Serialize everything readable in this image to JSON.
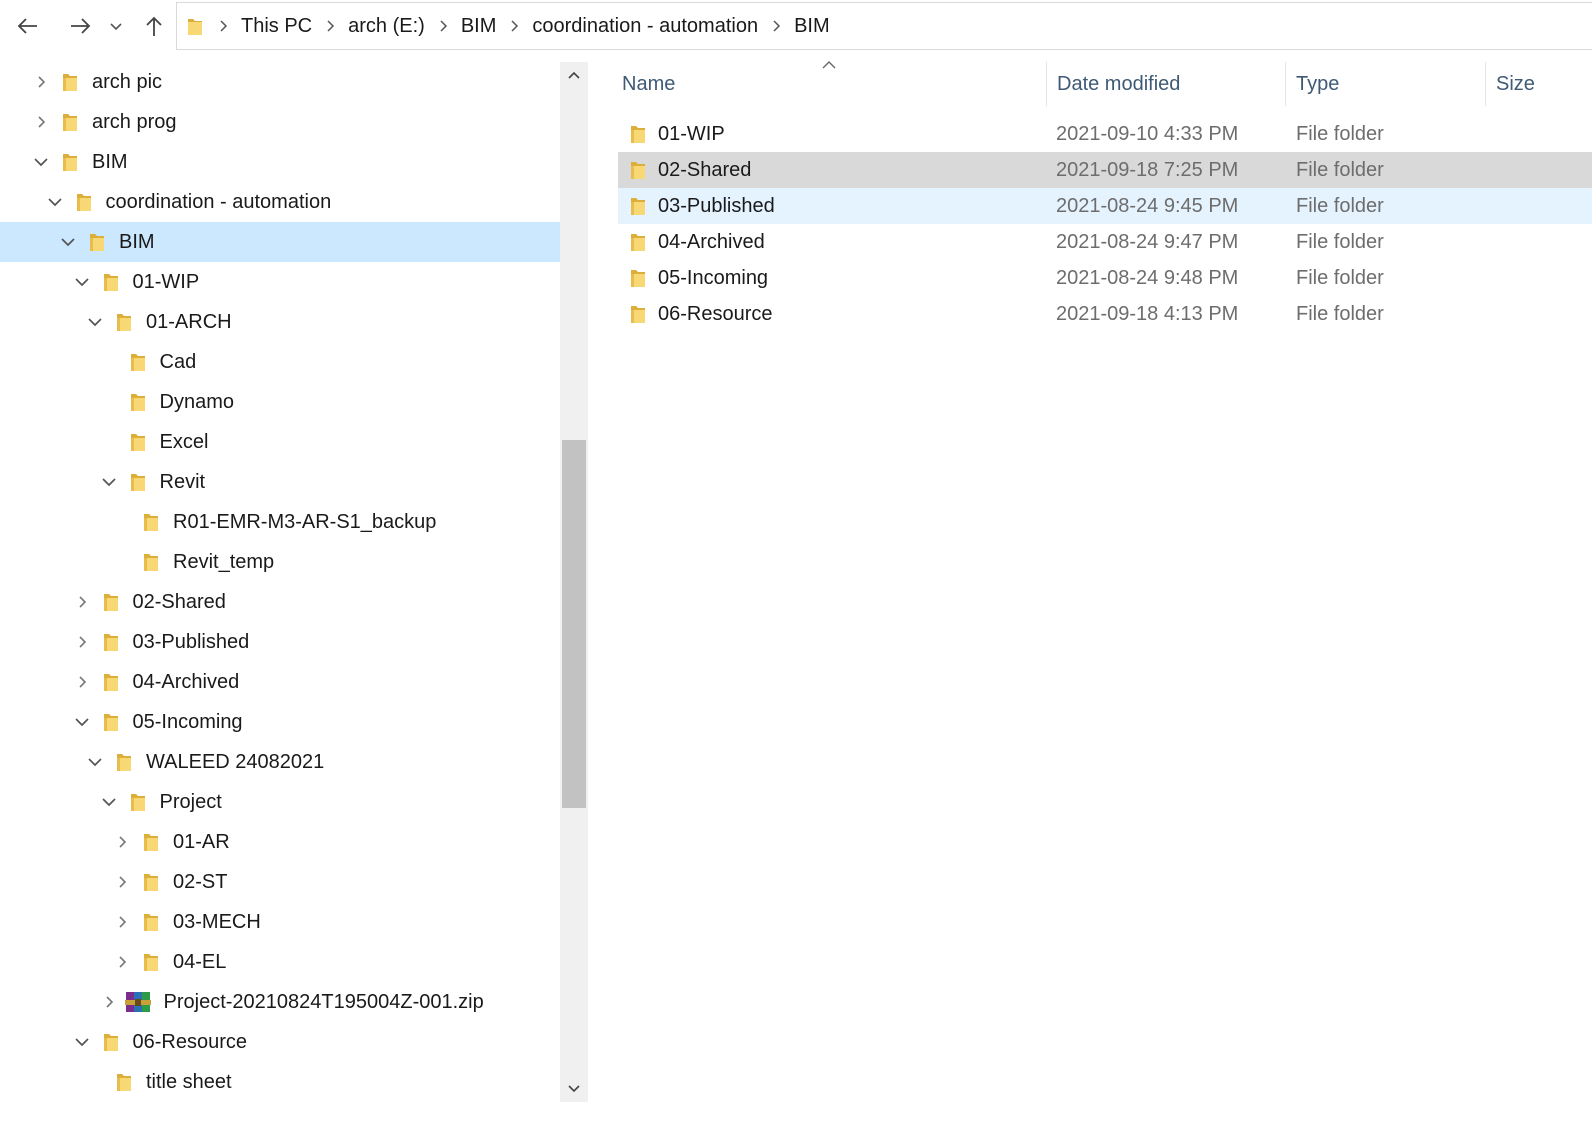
{
  "toolbar": {
    "back_icon": "arrow-left-icon",
    "forward_icon": "arrow-right-icon",
    "recent_icon": "chevron-down-icon",
    "up_icon": "arrow-up-icon",
    "breadcrumb": [
      "This PC",
      "arch (E:)",
      "BIM",
      "coordination - automation",
      "BIM"
    ]
  },
  "tree": {
    "items": [
      {
        "label": "arch pic",
        "level": 0,
        "state": "collapsed",
        "icon": "folder"
      },
      {
        "label": "arch prog",
        "level": 0,
        "state": "collapsed",
        "icon": "folder"
      },
      {
        "label": "BIM",
        "level": 0,
        "state": "expanded",
        "icon": "folder"
      },
      {
        "label": "coordination - automation",
        "level": 1,
        "state": "expanded",
        "icon": "folder"
      },
      {
        "label": "BIM",
        "level": 2,
        "state": "expanded",
        "icon": "folder",
        "selected": true
      },
      {
        "label": "01-WIP",
        "level": 3,
        "state": "expanded",
        "icon": "folder"
      },
      {
        "label": "01-ARCH",
        "level": 4,
        "state": "expanded",
        "icon": "folder"
      },
      {
        "label": "Cad",
        "level": 5,
        "state": "none",
        "icon": "folder"
      },
      {
        "label": "Dynamo",
        "level": 5,
        "state": "none",
        "icon": "folder"
      },
      {
        "label": "Excel",
        "level": 5,
        "state": "none",
        "icon": "folder"
      },
      {
        "label": "Revit",
        "level": 5,
        "state": "expanded",
        "icon": "folder"
      },
      {
        "label": "R01-EMR-M3-AR-S1_backup",
        "level": 6,
        "state": "none",
        "icon": "folder"
      },
      {
        "label": "Revit_temp",
        "level": 6,
        "state": "none",
        "icon": "folder"
      },
      {
        "label": "02-Shared",
        "level": 3,
        "state": "collapsed",
        "icon": "folder"
      },
      {
        "label": "03-Published",
        "level": 3,
        "state": "collapsed",
        "icon": "folder"
      },
      {
        "label": "04-Archived",
        "level": 3,
        "state": "collapsed",
        "icon": "folder"
      },
      {
        "label": "05-Incoming",
        "level": 3,
        "state": "expanded",
        "icon": "folder"
      },
      {
        "label": "WALEED 24082021",
        "level": 4,
        "state": "expanded",
        "icon": "folder"
      },
      {
        "label": "Project",
        "level": 5,
        "state": "expanded",
        "icon": "folder"
      },
      {
        "label": "01-AR",
        "level": 6,
        "state": "collapsed",
        "icon": "folder"
      },
      {
        "label": "02-ST",
        "level": 6,
        "state": "collapsed",
        "icon": "folder"
      },
      {
        "label": "03-MECH",
        "level": 6,
        "state": "collapsed",
        "icon": "folder"
      },
      {
        "label": "04-EL",
        "level": 6,
        "state": "collapsed",
        "icon": "folder"
      },
      {
        "label": "Project-20210824T195004Z-001.zip",
        "level": 5,
        "state": "collapsed",
        "icon": "zip"
      },
      {
        "label": "06-Resource",
        "level": 3,
        "state": "expanded",
        "icon": "folder"
      },
      {
        "label": "title sheet",
        "level": 4,
        "state": "none",
        "icon": "folder"
      }
    ]
  },
  "list": {
    "columns": {
      "name": "Name",
      "date": "Date modified",
      "type": "Type",
      "size": "Size"
    },
    "rows": [
      {
        "name": "01-WIP",
        "date": "2021-09-10 4:33 PM",
        "type": "File folder",
        "state": "normal"
      },
      {
        "name": "02-Shared",
        "date": "2021-09-18 7:25 PM",
        "type": "File folder",
        "state": "hover"
      },
      {
        "name": "03-Published",
        "date": "2021-08-24 9:45 PM",
        "type": "File folder",
        "state": "selected"
      },
      {
        "name": "04-Archived",
        "date": "2021-08-24 9:47 PM",
        "type": "File folder",
        "state": "normal"
      },
      {
        "name": "05-Incoming",
        "date": "2021-08-24 9:48 PM",
        "type": "File folder",
        "state": "normal"
      },
      {
        "name": "06-Resource",
        "date": "2021-09-18 4:13 PM",
        "type": "File folder",
        "state": "normal"
      }
    ]
  },
  "colors": {
    "tree_selected": "#cce8ff",
    "row_hover": "#d9d9d9",
    "row_selected": "#e5f3ff",
    "folder": "#f8d775",
    "header_text": "#3f5a75"
  }
}
